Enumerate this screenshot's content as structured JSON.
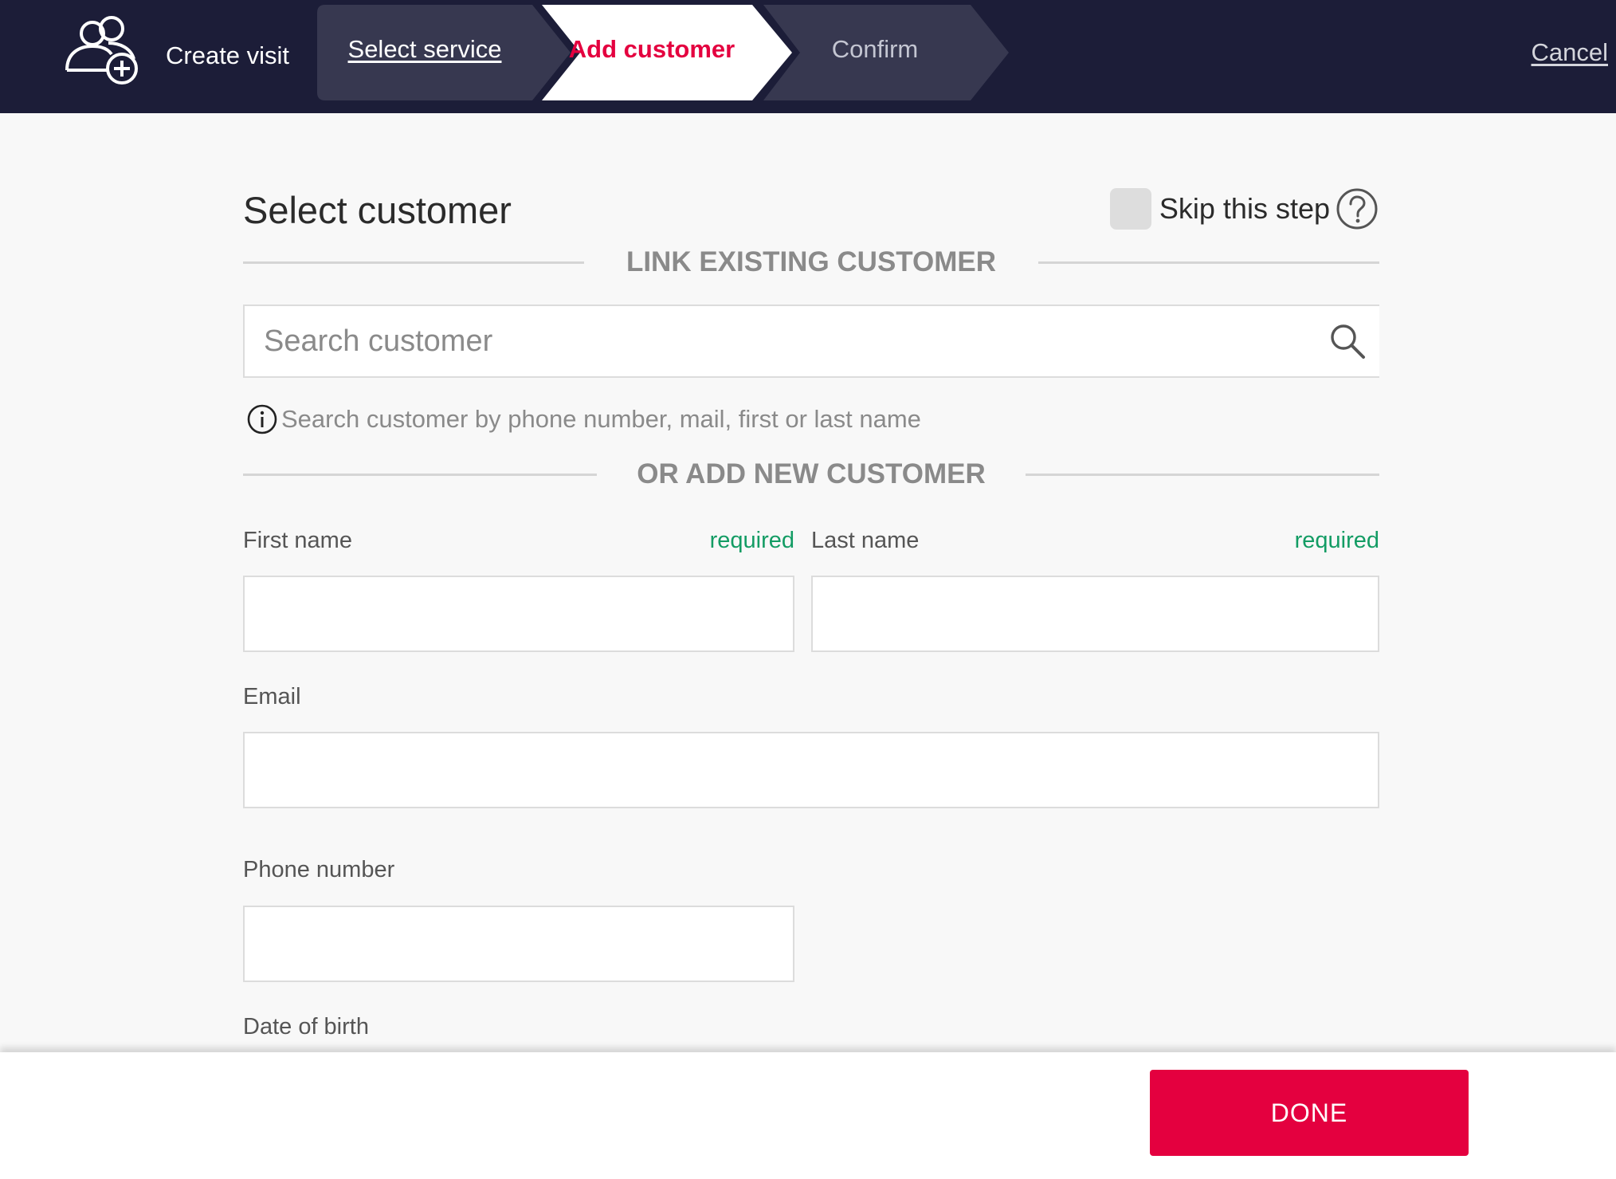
{
  "header": {
    "app_icon": "people-add-icon",
    "title": "Create visit",
    "steps": [
      {
        "label": "Select service",
        "state": "done"
      },
      {
        "label": "Add customer",
        "state": "active"
      },
      {
        "label": "Confirm",
        "state": "pending"
      }
    ],
    "cancel_label": "Cancel"
  },
  "main": {
    "title": "Select customer",
    "skip_label": "Skip this step",
    "skip_checked": false,
    "help_icon": "question-circle-icon",
    "link_section_label": "LINK EXISTING CUSTOMER",
    "search": {
      "placeholder": "Search customer",
      "value": "",
      "icon": "search-icon"
    },
    "hint": {
      "icon": "info-icon",
      "text": "Search customer by phone number, mail, first or last name"
    },
    "add_section_label": "OR ADD NEW CUSTOMER",
    "fields": {
      "first_name": {
        "label": "First name",
        "required": "required",
        "value": ""
      },
      "last_name": {
        "label": "Last name",
        "required": "required",
        "value": ""
      },
      "email": {
        "label": "Email",
        "value": ""
      },
      "phone": {
        "label": "Phone number",
        "value": ""
      },
      "dob": {
        "label": "Date of birth"
      }
    }
  },
  "footer": {
    "done_label": "DONE"
  },
  "colors": {
    "header_bg": "#1c1d38",
    "accent": "#e4003f",
    "required": "#139c64",
    "step_inactive_bg": "#373850"
  }
}
